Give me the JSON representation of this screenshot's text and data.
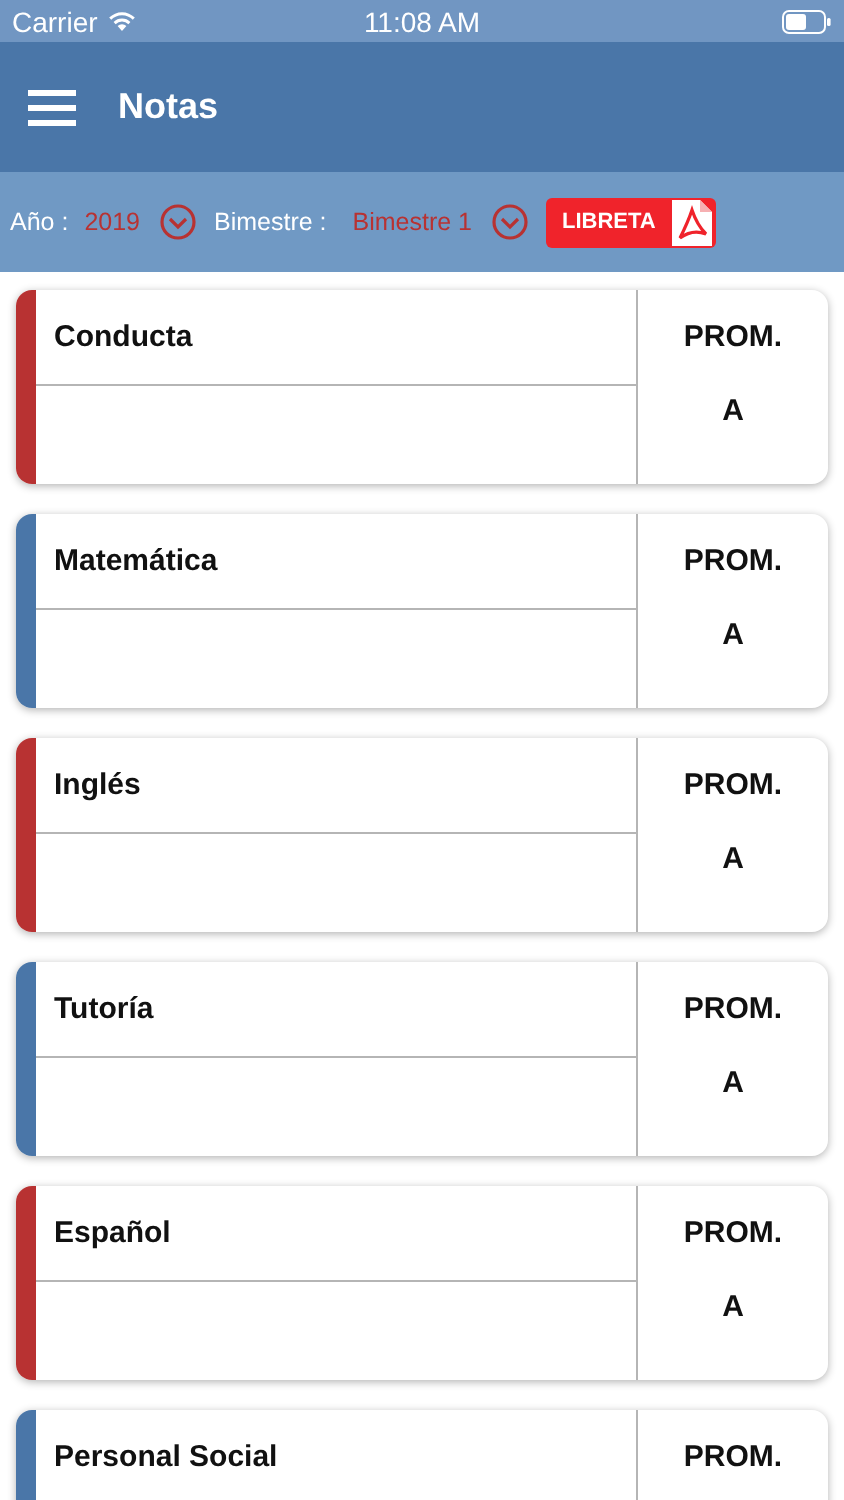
{
  "status_bar": {
    "carrier": "Carrier",
    "time": "11:08 AM"
  },
  "header": {
    "title": "Notas"
  },
  "filters": {
    "year_label": "Año :",
    "year_value": "2019",
    "term_label": "Bimestre :",
    "term_value": "Bimestre 1",
    "report_button": "LIBRETA"
  },
  "courses": [
    {
      "name": "Conducta",
      "color": "#b83232",
      "average_label": "PROM.",
      "average": "A"
    },
    {
      "name": "Matemática",
      "color": "#4a76a8",
      "average_label": "PROM.",
      "average": "A"
    },
    {
      "name": "Inglés",
      "color": "#b83232",
      "average_label": "PROM.",
      "average": "A"
    },
    {
      "name": "Tutoría",
      "color": "#4a76a8",
      "average_label": "PROM.",
      "average": "A"
    },
    {
      "name": "Español",
      "color": "#b83232",
      "average_label": "PROM.",
      "average": "A"
    },
    {
      "name": "Personal Social",
      "color": "#4a76a8",
      "average_label": "PROM."
    }
  ]
}
